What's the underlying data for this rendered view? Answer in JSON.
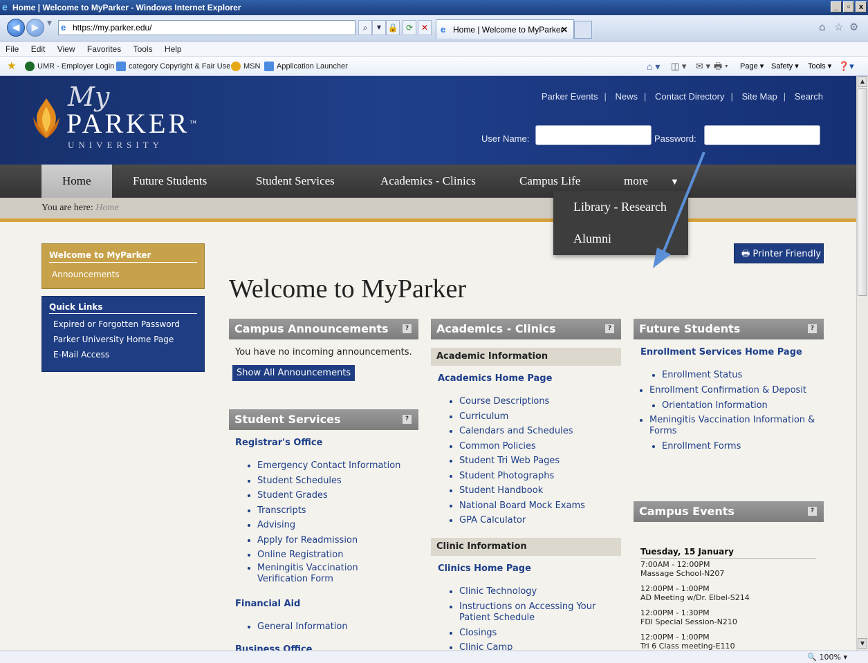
{
  "window": {
    "title": "Home | Welcome to MyParker - Windows Internet Explorer",
    "controls": [
      "_",
      "▫",
      "x"
    ]
  },
  "browser": {
    "url": "https://my.parker.edu/",
    "tab_title": "Home | Welcome to MyParker",
    "menu": [
      "File",
      "Edit",
      "View",
      "Favorites",
      "Tools",
      "Help"
    ],
    "favorites": [
      "UMR - Employer Login",
      "category Copyright & Fair Use",
      "MSN",
      "Application Launcher"
    ],
    "commands": [
      "Page ▾",
      "Safety ▾",
      "Tools ▾"
    ],
    "zoom": "100%"
  },
  "header": {
    "logo_my": "My",
    "logo_name": "PARKER",
    "logo_tm": "™",
    "logo_sub": "UNIVERSITY",
    "toplinks": [
      "Parker Events",
      "News",
      "Contact Directory",
      "Site Map",
      "Search"
    ],
    "username_label": "User Name:",
    "password_label": "Password:"
  },
  "nav": {
    "items": [
      "Home",
      "Future Students",
      "Student Services",
      "Academics - Clinics",
      "Campus Life",
      "more"
    ],
    "more_arrow": "▼"
  },
  "dropdown": {
    "items": [
      "Library - Research",
      "Alumni"
    ]
  },
  "breadcrumb": {
    "prefix": "You are here:",
    "current": "Home"
  },
  "leftnav": {
    "welcome_title": "Welcome to MyParker",
    "welcome_sub": "Announcements",
    "quick_title": "Quick Links",
    "quick_links": [
      "Expired or Forgotten Password",
      "Parker University Home Page",
      "E-Mail Access"
    ]
  },
  "printer_label": "Printer Friendly",
  "page_title": "Welcome to MyParker",
  "announcements": {
    "title": "Campus Announcements",
    "text": "You have no incoming announcements.",
    "button": "Show All Announcements"
  },
  "student_services": {
    "title": "Student Services",
    "registrar": "Registrar's Office",
    "registrar_links": [
      "Emergency Contact Information",
      "Student Schedules",
      "Student Grades",
      "Transcripts",
      "Advising",
      "Apply for Readmission",
      "Online Registration",
      "Meningitis Vaccination Verification Form"
    ],
    "financial": "Financial Aid",
    "financial_links": [
      "General Information"
    ],
    "business": "Business Office"
  },
  "academics": {
    "title": "Academics - Clinics",
    "academic_info": "Academic Information",
    "academic_home": "Academics Home Page",
    "academic_links": [
      "Course Descriptions",
      "Curriculum",
      "Calendars and Schedules",
      "Common Policies",
      "Student Tri Web Pages",
      "Student Photographs",
      "Student Handbook",
      "National Board Mock Exams",
      "GPA Calculator"
    ],
    "clinic_info": "Clinic Information",
    "clinic_home": "Clinics Home Page",
    "clinic_links": [
      "Clinic Technology",
      "Instructions on Accessing Your Patient Schedule",
      "Closings",
      "Clinic Camp"
    ]
  },
  "future": {
    "title": "Future Students",
    "enroll_home": "Enrollment Services Home Page",
    "links": [
      "Enrollment Status",
      "Enrollment Confirmation & Deposit",
      "Orientation Information",
      "Meningitis Vaccination Information & Forms",
      "Enrollment Forms"
    ]
  },
  "events": {
    "title": "Campus Events",
    "date": "Tuesday, 15 January",
    "items": [
      {
        "time": "7:00AM - 12:00PM",
        "name": "Massage School-N207"
      },
      {
        "time": "12:00PM - 1:00PM",
        "name": "AD Meeting w/Dr. Elbel-S214"
      },
      {
        "time": "12:00PM - 1:30PM",
        "name": "FDI Special Session-N210"
      },
      {
        "time": "12:00PM - 1:00PM",
        "name": "Tri 6 Class meeting-E110"
      }
    ]
  },
  "help_glyph": "?"
}
